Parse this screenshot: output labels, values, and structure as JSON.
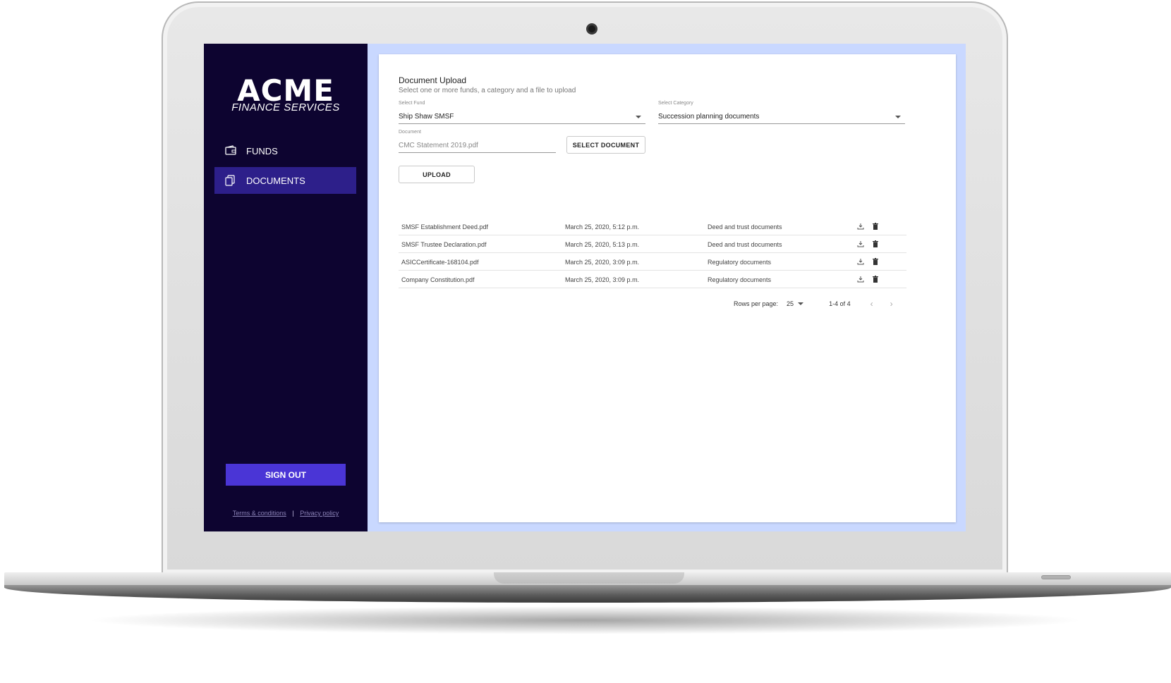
{
  "brand": {
    "name": "ACME",
    "tagline": "FINANCE SERVICES"
  },
  "sidebar": {
    "items": [
      {
        "label": "FUNDS",
        "icon": "wallet-icon"
      },
      {
        "label": "DOCUMENTS",
        "icon": "documents-icon",
        "active": true
      }
    ],
    "sign_out": "SIGN OUT",
    "terms": "Terms & conditions",
    "separator": "|",
    "privacy": "Privacy policy"
  },
  "upload": {
    "title": "Document Upload",
    "subtitle": "Select one or more funds, a category and a file to upload",
    "fund_label": "Select Fund",
    "fund_value": "Ship Shaw SMSF",
    "category_label": "Select Category",
    "category_value": "Succession planning documents",
    "document_label": "Document",
    "document_value": "CMC Statement 2019.pdf",
    "select_button": "SELECT DOCUMENT",
    "upload_button": "UPLOAD"
  },
  "documents": {
    "rows": [
      {
        "name": "SMSF Establishment Deed.pdf",
        "date": "March 25, 2020, 5:12 p.m.",
        "category": "Deed and trust documents"
      },
      {
        "name": "SMSF Trustee Declaration.pdf",
        "date": "March 25, 2020, 5:13 p.m.",
        "category": "Deed and trust documents"
      },
      {
        "name": "ASICCertificate-168104.pdf",
        "date": "March 25, 2020, 3:09 p.m.",
        "category": "Regulatory documents"
      },
      {
        "name": "Company Constitution.pdf",
        "date": "March 25, 2020, 3:09 p.m.",
        "category": "Regulatory documents"
      }
    ]
  },
  "pagination": {
    "rows_per_page_label": "Rows per page:",
    "rows_per_page": "25",
    "range": "1-4 of 4",
    "prev": "‹",
    "next": "›"
  },
  "colors": {
    "sidebar_bg": "#0d0430",
    "active_item": "#2d1f8a",
    "accent": "#4a35d6"
  }
}
